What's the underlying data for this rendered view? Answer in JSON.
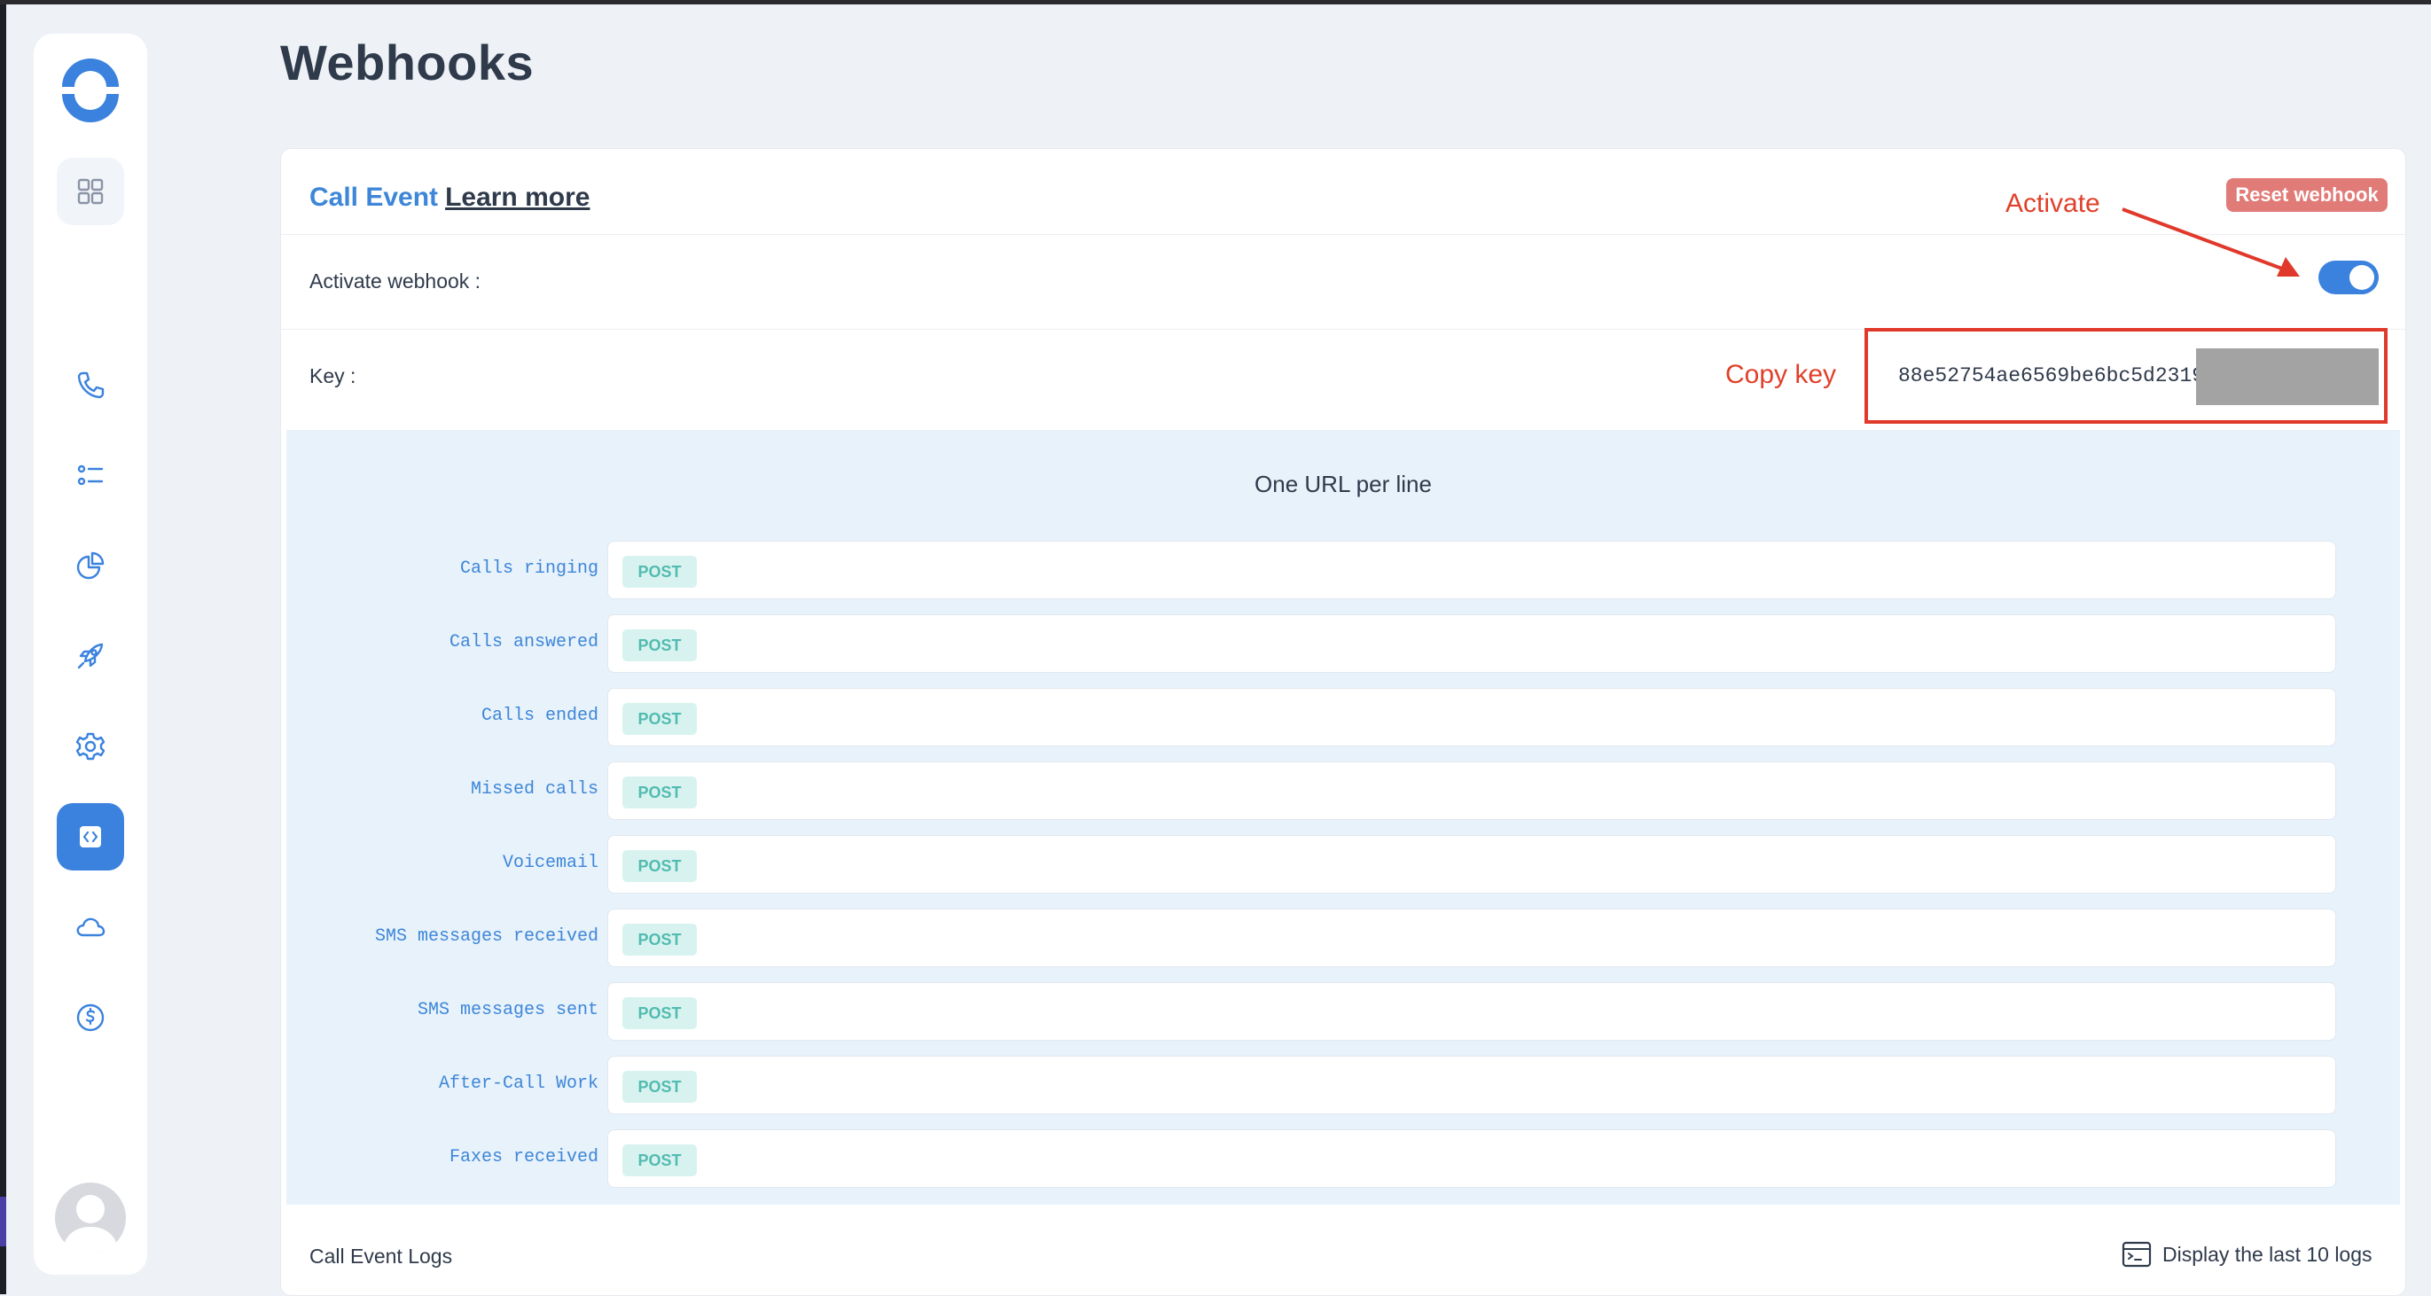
{
  "page": {
    "title": "Webhooks"
  },
  "sidebar": {
    "logo": "app-logo",
    "items": [
      {
        "name": "dashboard-grid",
        "icon": "grid-icon"
      },
      {
        "name": "calls",
        "icon": "phone-icon"
      },
      {
        "name": "lists",
        "icon": "list-icon"
      },
      {
        "name": "analytics",
        "icon": "pie-chart-icon"
      },
      {
        "name": "integrations",
        "icon": "rocket-icon"
      },
      {
        "name": "settings",
        "icon": "gear-icon"
      },
      {
        "name": "developers",
        "icon": "code-icon",
        "active": true
      },
      {
        "name": "cloud",
        "icon": "cloud-icon"
      },
      {
        "name": "billing",
        "icon": "dollar-icon"
      }
    ],
    "avatar": "user-avatar"
  },
  "card": {
    "event_title": "Call Event",
    "learn_more": "Learn more",
    "reset_button": "Reset webhook",
    "activate_label": "Activate webhook :",
    "activate_on": true,
    "key_label": "Key :",
    "key_value": "88e52754ae6569be6bc5d2319"
  },
  "urls": {
    "title": "One URL per line",
    "method": "POST",
    "rows": [
      {
        "label": "Calls ringing",
        "value": ""
      },
      {
        "label": "Calls answered",
        "value": ""
      },
      {
        "label": "Calls ended",
        "value": ""
      },
      {
        "label": "Missed calls",
        "value": ""
      },
      {
        "label": "Voicemail",
        "value": ""
      },
      {
        "label": "SMS messages received",
        "value": ""
      },
      {
        "label": "SMS messages sent",
        "value": ""
      },
      {
        "label": "After-Call Work",
        "value": ""
      },
      {
        "label": "Faxes received",
        "value": ""
      }
    ]
  },
  "logs": {
    "label": "Call Event Logs",
    "link": "Display the last 10 logs"
  },
  "annotations": {
    "activate": "Activate",
    "copy_key": "Copy key"
  },
  "colors": {
    "accent": "#3b82de",
    "annotation": "#e0402a",
    "reset": "#e17b78",
    "post_badge": "#52bbb1"
  }
}
